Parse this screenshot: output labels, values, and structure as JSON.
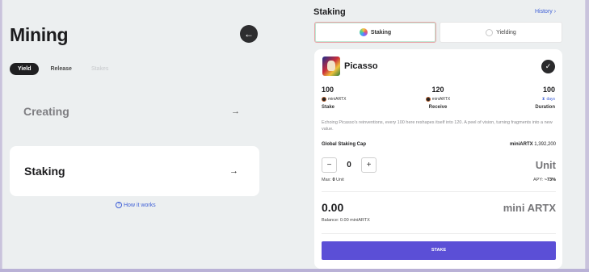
{
  "left": {
    "title": "Mining",
    "back_icon": "arrow-left-icon",
    "tabs": [
      {
        "label": "Yield",
        "state": "active"
      },
      {
        "label": "Release",
        "state": "normal"
      },
      {
        "label": "Stakes",
        "state": "disabled"
      }
    ],
    "rows": [
      {
        "label": "Creating",
        "arrow": "→"
      },
      {
        "label": "Staking",
        "arrow": "→"
      }
    ],
    "how_it_works": "How it works"
  },
  "right": {
    "heading": "Staking",
    "history": "History",
    "history_chevron": "›",
    "segments": [
      {
        "label": "Staking",
        "selected": true
      },
      {
        "label": "Yielding",
        "selected": false
      }
    ],
    "card": {
      "name": "Picasso",
      "stats": [
        {
          "value": "100",
          "token": "miniARTX",
          "label": "Stake"
        },
        {
          "value": "120",
          "token": "miniARTX",
          "label": "Receive"
        },
        {
          "value": "100",
          "token": "days",
          "label": "Duration"
        }
      ],
      "description": "Echoing Picasso's reinventions, every 100 here reshapes itself into 120. A peel of vision, turning fragments into a new value.",
      "cap_label": "Global Staking Cap",
      "cap_token": "miniARTX",
      "cap_value": "1,392,200",
      "stepper": {
        "minus": "−",
        "value": "0",
        "plus": "+"
      },
      "unit_label": "Unit",
      "max_label": "Max:",
      "max_value": "0",
      "max_unit": "Unit",
      "apy_label": "APY:",
      "apy_value": "~73%",
      "amount": "0.00",
      "amount_unit": "mini ARTX",
      "balance": "Balance: 0.00 miniARTX",
      "button": "STAKE"
    }
  },
  "colors": {
    "accent": "#5b4fd6",
    "link": "#3e5fd6",
    "background": "#eceff0"
  }
}
